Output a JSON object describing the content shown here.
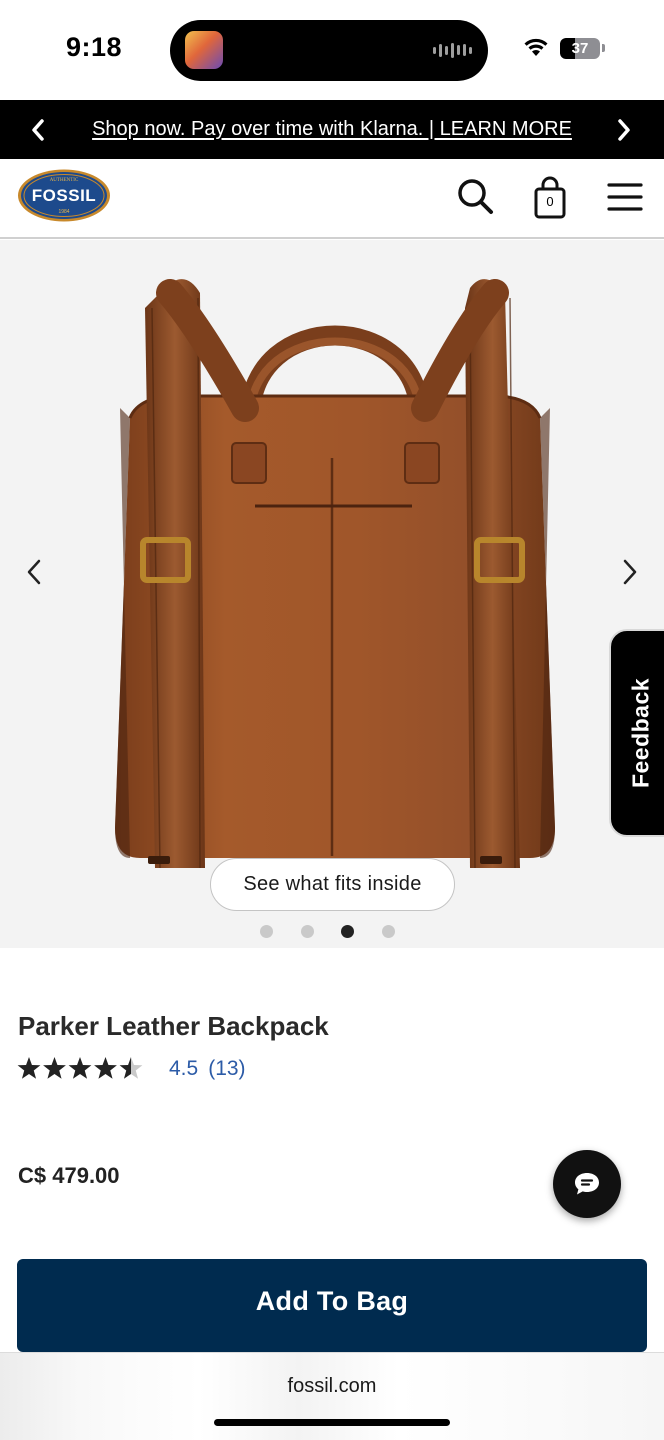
{
  "status_bar": {
    "time": "9:18",
    "battery": "37",
    "battery_level": 0.37
  },
  "promo": {
    "text": "Shop now. Pay over time with Klarna. | LEARN MORE",
    "prev_icon": "chevron-left-icon",
    "next_icon": "chevron-right-icon"
  },
  "header": {
    "logo_top": "AUTHENTIC",
    "logo_brand": "FOSSIL",
    "logo_bottom": "1984",
    "bag_count": "0",
    "icons": [
      "search-icon",
      "shopping-bag-icon",
      "hamburger-menu-icon"
    ]
  },
  "gallery": {
    "fits_button": "See what fits inside",
    "image_count": 4,
    "active_index": 2
  },
  "feedback": {
    "label": "Feedback"
  },
  "product": {
    "name": "Parker Leather Backpack",
    "rating": 4.5,
    "rating_text": "4.5",
    "review_count": "(13)",
    "price": "C$ 479.00",
    "add_to_bag": "Add To Bag"
  },
  "browser": {
    "url": "fossil.com"
  },
  "colors": {
    "promo_bg": "#000000",
    "button_navy": "#002b4f",
    "rating_blue": "#2c5ba7",
    "leather": "#8b4a22"
  }
}
